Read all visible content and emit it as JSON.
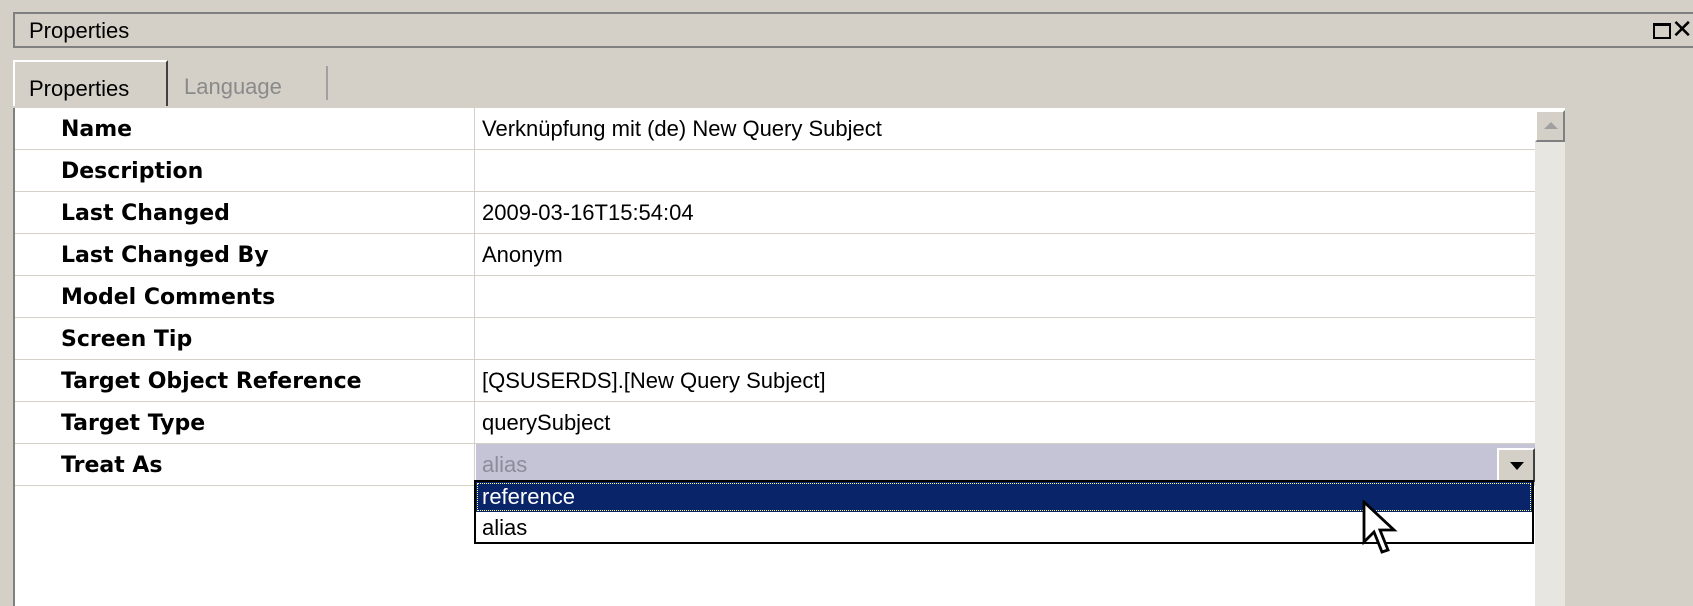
{
  "window": {
    "title": "Properties",
    "maximize_glyph": "□",
    "close_glyph": "✕"
  },
  "tabs": [
    {
      "label": "Properties",
      "active": true
    },
    {
      "label": "Language",
      "active": false
    }
  ],
  "properties": [
    {
      "name": "Name",
      "value": "Verknüpfung mit (de) New Query Subject"
    },
    {
      "name": "Description",
      "value": ""
    },
    {
      "name": "Last Changed",
      "value": "2009-03-16T15:54:04"
    },
    {
      "name": "Last Changed By",
      "value": "Anonym"
    },
    {
      "name": "Model Comments",
      "value": ""
    },
    {
      "name": "Screen Tip",
      "value": ""
    },
    {
      "name": "Target Object Reference",
      "value": "[QSUSERDS].[New Query Subject]"
    },
    {
      "name": "Target Type",
      "value": "querySubject"
    },
    {
      "name": "Treat As",
      "value": "alias"
    }
  ],
  "dropdown": {
    "options": [
      "reference",
      "alias"
    ],
    "highlighted": "reference"
  },
  "colors": {
    "panel": "#d4d0c8",
    "selection": "#0a246a",
    "treat_as_row": "#c5c4d6"
  },
  "icons": {
    "dropdown": "chevron-down-icon",
    "scroll_up": "scroll-up-arrow-icon",
    "cursor": "mouse-pointer-icon"
  }
}
